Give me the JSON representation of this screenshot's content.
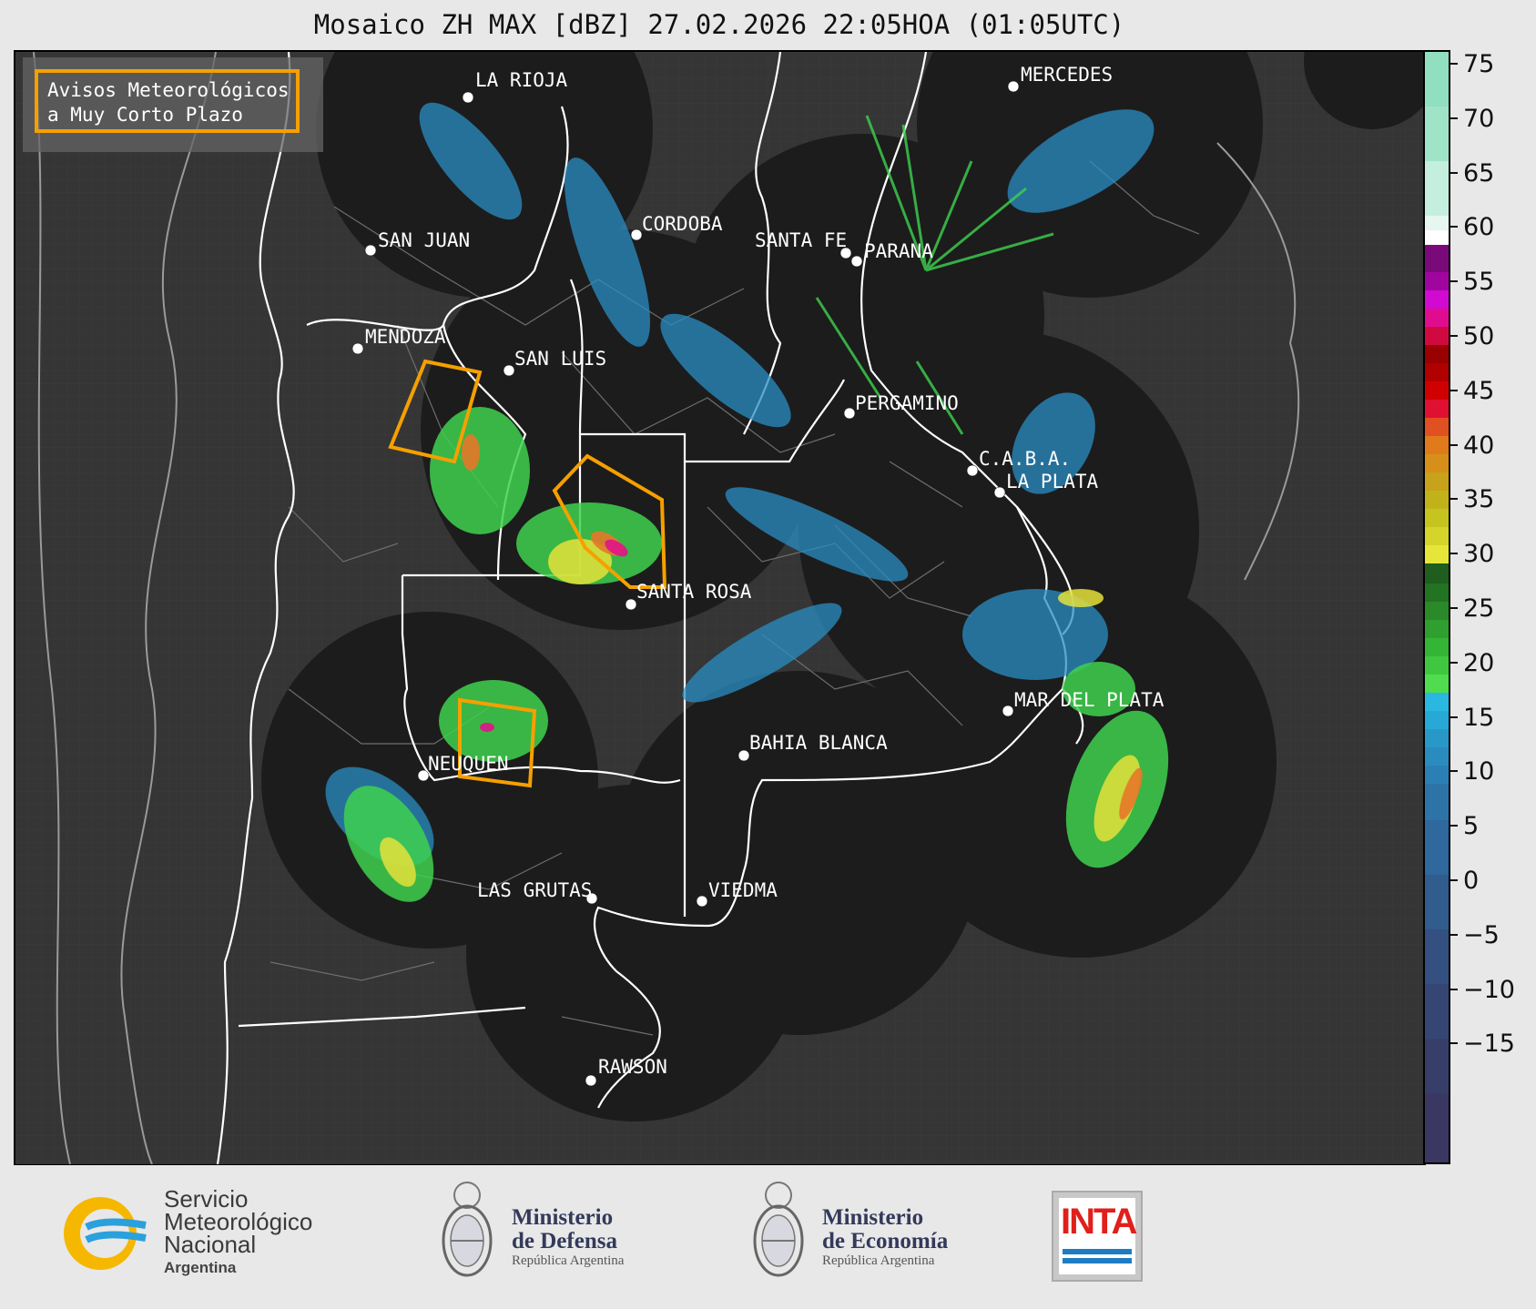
{
  "title": "Mosaico ZH MAX [dBZ] 27.02.2026 22:05HOA (01:05UTC)",
  "legend": {
    "line1": "Avisos Meteorológicos",
    "line2": "a Muy Corto Plazo",
    "border_color": "#f5a000"
  },
  "colorbar": {
    "unit": "dBZ",
    "ticks": [
      "75",
      "70",
      "65",
      "60",
      "55",
      "50",
      "45",
      "40",
      "35",
      "30",
      "25",
      "20",
      "15",
      "10",
      "5",
      "0",
      "−5",
      "−10",
      "−15"
    ]
  },
  "cities": [
    {
      "name": "LA RIOJA"
    },
    {
      "name": "SAN JUAN"
    },
    {
      "name": "CORDOBA"
    },
    {
      "name": "SANTA FE"
    },
    {
      "name": "PARANA"
    },
    {
      "name": "MERCEDES"
    },
    {
      "name": "MENDOZA"
    },
    {
      "name": "SAN LUIS"
    },
    {
      "name": "PERGAMINO"
    },
    {
      "name": "C.A.B.A."
    },
    {
      "name": "LA PLATA"
    },
    {
      "name": "SANTA ROSA"
    },
    {
      "name": "MAR DEL PLATA"
    },
    {
      "name": "BAHIA BLANCA"
    },
    {
      "name": "NEUQUEN"
    },
    {
      "name": "LAS GRUTAS"
    },
    {
      "name": "VIEDMA"
    },
    {
      "name": "RAWSON"
    }
  ],
  "logos": {
    "smn_line1": "Servicio",
    "smn_line2": "Meteorológico",
    "smn_line3": "Nacional",
    "smn_sub": "Argentina",
    "defensa_line1": "Ministerio",
    "defensa_line2": "de Defensa",
    "defensa_line3": "República Argentina",
    "economia_line1": "Ministerio",
    "economia_line2": "de Economía",
    "economia_line3": "República Argentina",
    "inta": "INTA"
  }
}
